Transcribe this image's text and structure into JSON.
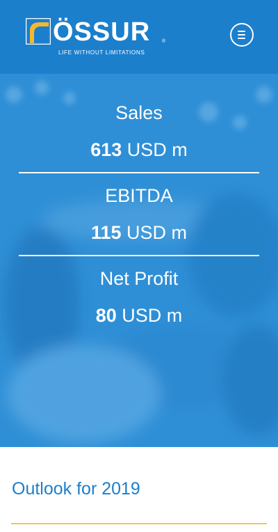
{
  "header": {
    "logo_word": "ÖSSUR",
    "logo_tagline": "LIFE WITHOUT LIMITATIONS",
    "logo_reg": "®",
    "menu_icon": "hamburger-circle-icon",
    "bg_color": "#1b7fcc"
  },
  "stats": [
    {
      "label": "Sales",
      "value": "613",
      "unit": "USD m"
    },
    {
      "label": "EBITDA",
      "value": "115",
      "unit": "USD m"
    },
    {
      "label": "Net Profit",
      "value": "80",
      "unit": "USD m"
    }
  ],
  "outlook": {
    "title": "Outlook for 2019",
    "accent_color": "#f2c45c"
  }
}
